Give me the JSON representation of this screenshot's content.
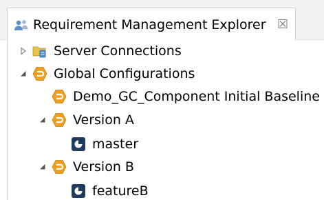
{
  "view": {
    "title": "Requirement Management Explorer",
    "close_glyph": "☒",
    "icon": "people-icon"
  },
  "tree": {
    "server_connections": {
      "label": "Server Connections",
      "expanded": false,
      "icon": "folder-server-icon"
    },
    "global_configurations": {
      "label": "Global Configurations",
      "expanded": true,
      "icon": "global-config-icon"
    },
    "baseline": {
      "label": "Demo_GC_Component Initial Baseline",
      "icon": "global-config-icon"
    },
    "version_a": {
      "label": "Version A",
      "expanded": true,
      "icon": "global-config-icon"
    },
    "master": {
      "label": "master",
      "icon": "stream-icon"
    },
    "version_b": {
      "label": "Version B",
      "expanded": true,
      "icon": "global-config-icon"
    },
    "featureb": {
      "label": "featureB",
      "icon": "stream-icon"
    }
  },
  "colors": {
    "config_orange": "#f0a020",
    "stream_navy": "#1e3a5c",
    "folder_yellow": "#e8c34a",
    "server_blue": "#4f8fd6"
  }
}
